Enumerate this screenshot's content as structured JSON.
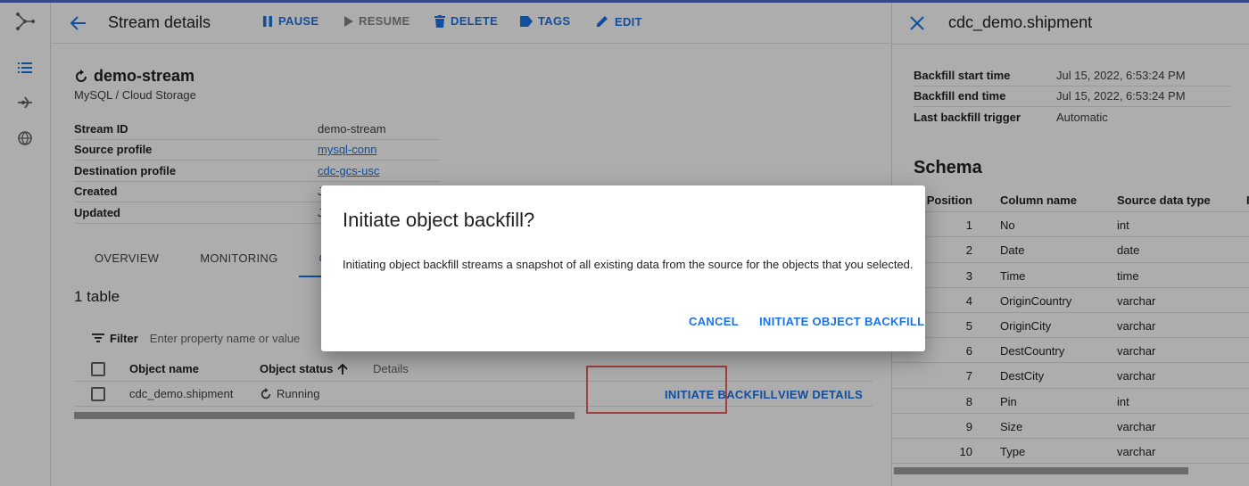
{
  "colors": {
    "accent": "#1a73e8",
    "scrim": "rgba(0,0,0,0.32)",
    "highlight": "#a04040"
  },
  "rail": {
    "items": [
      "datastream-logo-icon",
      "list-icon",
      "connection-profile-icon",
      "private-connectivity-icon"
    ]
  },
  "header": {
    "title": "Stream details",
    "pause": "PAUSE",
    "resume": "RESUME",
    "delete": "DELETE",
    "tags": "TAGS",
    "edit": "EDIT"
  },
  "stream": {
    "name": "demo-stream",
    "subtitle": "MySQL / Cloud Storage",
    "props": [
      {
        "k": "Stream ID",
        "v": "demo-stream"
      },
      {
        "k": "Source profile",
        "v": "mysql-conn"
      },
      {
        "k": "Destination profile",
        "v": "cdc-gcs-usc"
      },
      {
        "k": "Created",
        "v": "J"
      },
      {
        "k": "Updated",
        "v": "J"
      }
    ]
  },
  "tabs": [
    "OVERVIEW",
    "MONITORING",
    "OBJ"
  ],
  "objects": {
    "count_label": "1 table",
    "filter_label": "Filter",
    "filter_placeholder": "Enter property name or value",
    "headers": {
      "name": "Object name",
      "status": "Object status",
      "details": "Details"
    },
    "rows": [
      {
        "name": "cdc_demo.shipment",
        "status": "Running",
        "init": "INITIATE BACKFILL",
        "view": "VIEW DETAILS"
      }
    ]
  },
  "panel": {
    "title": "cdc_demo.shipment",
    "props": [
      {
        "k": "Backfill start time",
        "v": "Jul 15, 2022, 6:53:24 PM"
      },
      {
        "k": "Backfill end time",
        "v": "Jul 15, 2022, 6:53:24 PM"
      },
      {
        "k": "Last backfill trigger",
        "v": "Automatic"
      }
    ],
    "schema_title": "Schema",
    "schema_headers": {
      "pos": "Position",
      "col": "Column name",
      "type": "Source data type"
    },
    "schema_rows": [
      {
        "pos": "1",
        "col": "No",
        "type": "int"
      },
      {
        "pos": "2",
        "col": "Date",
        "type": "date"
      },
      {
        "pos": "3",
        "col": "Time",
        "type": "time"
      },
      {
        "pos": "4",
        "col": "OriginCountry",
        "type": "varchar"
      },
      {
        "pos": "5",
        "col": "OriginCity",
        "type": "varchar"
      },
      {
        "pos": "6",
        "col": "DestCountry",
        "type": "varchar"
      },
      {
        "pos": "7",
        "col": "DestCity",
        "type": "varchar"
      },
      {
        "pos": "8",
        "col": "Pin",
        "type": "int"
      },
      {
        "pos": "9",
        "col": "Size",
        "type": "varchar"
      },
      {
        "pos": "10",
        "col": "Type",
        "type": "varchar"
      }
    ]
  },
  "dialog": {
    "title": "Initiate object backfill?",
    "body": "Initiating object backfill streams a snapshot of all existing data from the source for the objects that you selected.",
    "cancel": "CANCEL",
    "confirm": "INITIATE OBJECT BACKFILL"
  }
}
